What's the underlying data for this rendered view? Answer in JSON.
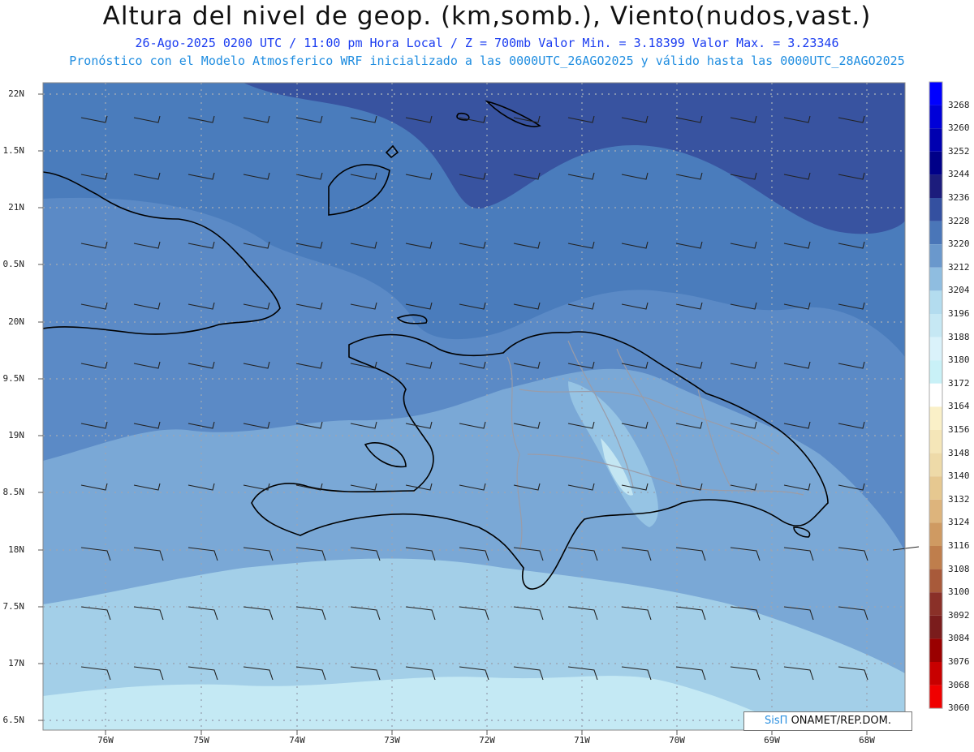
{
  "header": {
    "title": "Altura del nivel de geop. (km,somb.), Viento(nudos,vast.)",
    "subtitle1": "26-Ago-2025  0200 UTC / 11:00 pm Hora Local / Z = 700mb    Valor Min. = 3.18399  Valor Max. = 3.23346",
    "subtitle2": "Pronóstico con el Modelo Atmosferico WRF inicializado a las 0000UTC_26AGO2025 y válido hasta las  0000UTC_28AGO2025"
  },
  "axes": {
    "lat_labels": [
      "22N",
      "1.5N",
      "21N",
      "0.5N",
      "20N",
      "9.5N",
      "19N",
      "8.5N",
      "18N",
      "7.5N",
      "17N",
      "6.5N"
    ],
    "lon_labels": [
      "76W",
      "75W",
      "74W",
      "73W",
      "72W",
      "71W",
      "70W",
      "69W",
      "68W"
    ]
  },
  "colorbar": {
    "levels": [
      "3268",
      "3260",
      "3252",
      "3244",
      "3236",
      "3228",
      "3220",
      "3212",
      "3204",
      "3196",
      "3188",
      "3180",
      "3172",
      "3164",
      "3156",
      "3148",
      "3140",
      "3132",
      "3124",
      "3116",
      "3108",
      "3100",
      "3092",
      "3084",
      "3076",
      "3068",
      "3060"
    ],
    "colors": [
      "#0000ff",
      "#0000d8",
      "#0000b0",
      "#000088",
      "#1c1c7c",
      "#3450a0",
      "#4a76b8",
      "#6a98cc",
      "#8fbde0",
      "#b3dcef",
      "#c6e8f4",
      "#daf2fa",
      "#c9f1f7",
      "#ffffff",
      "#faf0c8",
      "#f5e6b8",
      "#eedaa8",
      "#e6c890",
      "#ddb47c",
      "#cf9a62",
      "#bf7e4c",
      "#a85a3a",
      "#8a3028",
      "#7a1c1c",
      "#9a0000",
      "#c80000",
      "#f00000"
    ]
  },
  "credit": {
    "logo": "SisΠ",
    "text": " ONAMET/REP.DOM."
  }
}
